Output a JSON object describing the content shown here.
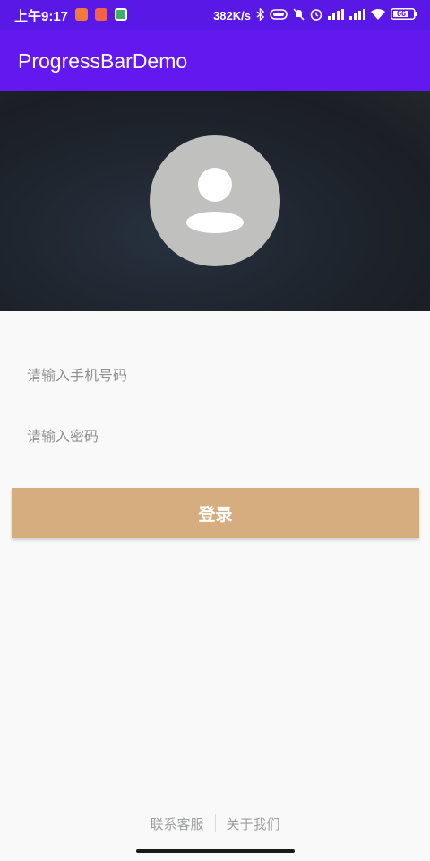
{
  "status_bar": {
    "time": "上午9:17",
    "network_speed": "382K/s",
    "battery_level": "66",
    "icons": [
      "weibo-icon",
      "video-app-icon",
      "gallery-app-icon",
      "bluetooth-icon",
      "vibrate-icon",
      "mute-icon",
      "alarm-icon",
      "signal-icon",
      "signal-icon",
      "wifi-icon",
      "battery-icon"
    ]
  },
  "app_bar": {
    "title": "ProgressBarDemo",
    "color": "#6218ee"
  },
  "header": {
    "avatar_icon": "user-avatar-icon"
  },
  "form": {
    "phone_placeholder": "请输入手机号码",
    "password_placeholder": "请输入密码",
    "login_label": "登录",
    "login_color": "#d6ad7e"
  },
  "footer": {
    "contact_label": "联系客服",
    "about_label": "关于我们"
  }
}
